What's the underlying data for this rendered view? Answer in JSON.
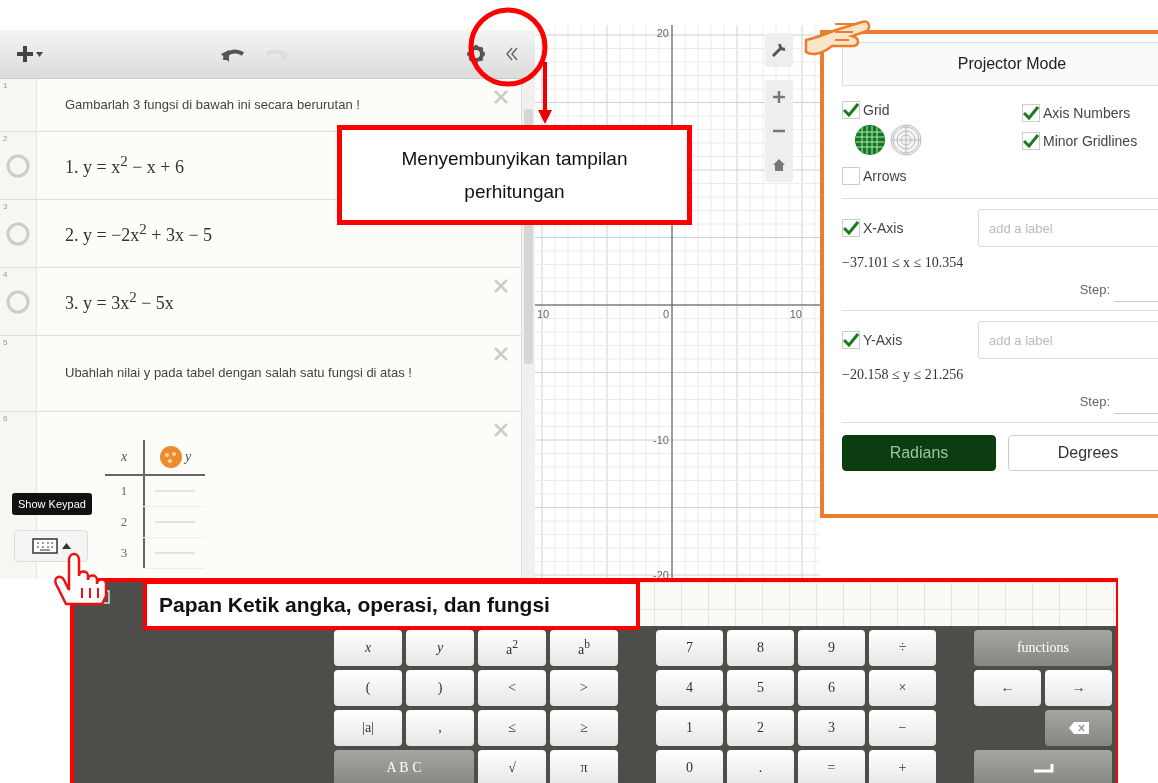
{
  "toolbar": {
    "undo_enabled": true,
    "redo_enabled": false
  },
  "expressions": [
    {
      "index": "1",
      "close_shown": true,
      "kind": "note",
      "text": "Gambarlah 3 fungsi di bawah ini secara berurutan !"
    },
    {
      "index": "2",
      "close_shown": false,
      "kind": "function",
      "text": "1. y = x$^{2}$ − x + 6"
    },
    {
      "index": "3",
      "close_shown": false,
      "kind": "function",
      "text": "2. y = −2x$^{2}$ + 3x − 5"
    },
    {
      "index": "4",
      "close_shown": true,
      "kind": "function",
      "text": "3. y = 3x$^{2}$ − 5x"
    },
    {
      "index": "5",
      "close_shown": true,
      "kind": "note",
      "text": "Ubahlah nilai y pada tabel dengan salah satu fungsi di atas !"
    },
    {
      "index": "6",
      "close_shown": true,
      "kind": "table",
      "columns": [
        "x",
        "y"
      ],
      "rows": [
        "1",
        "2",
        "3"
      ]
    }
  ],
  "tooltip": "Show Keypad",
  "graph": {
    "axis_numbers": {
      "y_max": "20",
      "x_min": "10",
      "origin": "0",
      "x_max": "10",
      "y_mid": "-10",
      "y_min": "-20"
    }
  },
  "settings": {
    "title": "Projector Mode",
    "grid": {
      "label": "Grid",
      "checked": true
    },
    "grid_types": [
      {
        "kind": "cartesian",
        "selected": true
      },
      {
        "kind": "polar",
        "selected": false
      }
    ],
    "axis_numbers": {
      "label": "Axis Numbers",
      "checked": true
    },
    "minor_gridlines": {
      "label": "Minor Gridlines",
      "checked": true
    },
    "arrows": {
      "label": "Arrows",
      "checked": false
    },
    "axes": [
      {
        "label": "X-Axis",
        "checked": true,
        "placeholder": "add a label",
        "range": "−37.101 ≤ x ≤ 10.354",
        "step_label": "Step:"
      },
      {
        "label": "Y-Axis",
        "checked": true,
        "placeholder": "add a label",
        "range": "−20.158 ≤ y ≤ 21.256",
        "step_label": "Step:"
      }
    ],
    "angle_units": [
      {
        "label": "Radians",
        "selected": true
      },
      {
        "label": "Degrees",
        "selected": false
      }
    ]
  },
  "keypad": {
    "math_keys": [
      {
        "label": "x",
        "kind": "light"
      },
      {
        "label": "y",
        "kind": "light"
      },
      {
        "label": "a$^{2}$",
        "kind": "light"
      },
      {
        "label": "a$^{b}$",
        "kind": "light"
      },
      {
        "label": "(",
        "kind": "light"
      },
      {
        "label": ")",
        "kind": "light"
      },
      {
        "label": "<",
        "kind": "light"
      },
      {
        "label": ">",
        "kind": "light"
      },
      {
        "label": "|a|",
        "kind": "light"
      },
      {
        "label": ",",
        "kind": "light"
      },
      {
        "label": "≤",
        "kind": "light"
      },
      {
        "label": "≥",
        "kind": "light"
      },
      {
        "label": "A B C",
        "kind": "wide-dark"
      },
      {
        "label": "√",
        "kind": "light"
      },
      {
        "label": "π",
        "kind": "light"
      }
    ],
    "number_keys": [
      {
        "label": "7"
      },
      {
        "label": "8"
      },
      {
        "label": "9"
      },
      {
        "label": "÷"
      },
      {
        "label": "4"
      },
      {
        "label": "5"
      },
      {
        "label": "6"
      },
      {
        "label": "×"
      },
      {
        "label": "1"
      },
      {
        "label": "2"
      },
      {
        "label": "3"
      },
      {
        "label": "−"
      },
      {
        "label": "0"
      },
      {
        "label": "."
      },
      {
        "label": "="
      },
      {
        "label": "+"
      }
    ],
    "action_keys": [
      {
        "kind": "functions",
        "label": "functions"
      },
      {
        "kind": "left",
        "label": "←"
      },
      {
        "kind": "right",
        "label": "→"
      },
      {
        "kind": "backspace"
      },
      {
        "kind": "enter"
      }
    ]
  },
  "annotations": {
    "hide_callout": "Menyembunyikan tampilan perhitungan",
    "keypad_label": "Papan Ketik angka, operasi, dan fungsi"
  }
}
